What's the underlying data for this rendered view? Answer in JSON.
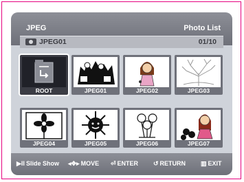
{
  "header": {
    "title": "JPEG",
    "right_label": "Photo List"
  },
  "subbar": {
    "album": "JPEG01",
    "page": "01/10",
    "icon": "camera-icon"
  },
  "thumbnails": [
    {
      "label": "ROOT",
      "icon": "folder-up-icon",
      "selected": true
    },
    {
      "label": "JPEG01",
      "icon": "sheep-people-image"
    },
    {
      "label": "JPEG02",
      "icon": "girl-image"
    },
    {
      "label": "JPEG03",
      "icon": "tree-image"
    },
    {
      "label": "JPEG04",
      "icon": "flower-image"
    },
    {
      "label": "JPEG05",
      "icon": "sun-image"
    },
    {
      "label": "JPEG06",
      "icon": "flowers-image"
    },
    {
      "label": "JPEG07",
      "icon": "girl-flowers-image"
    }
  ],
  "footer": {
    "slideshow": "Slide Show",
    "move": "MOVE",
    "enter": "ENTER",
    "return": "RETURN",
    "exit": "EXIT"
  }
}
